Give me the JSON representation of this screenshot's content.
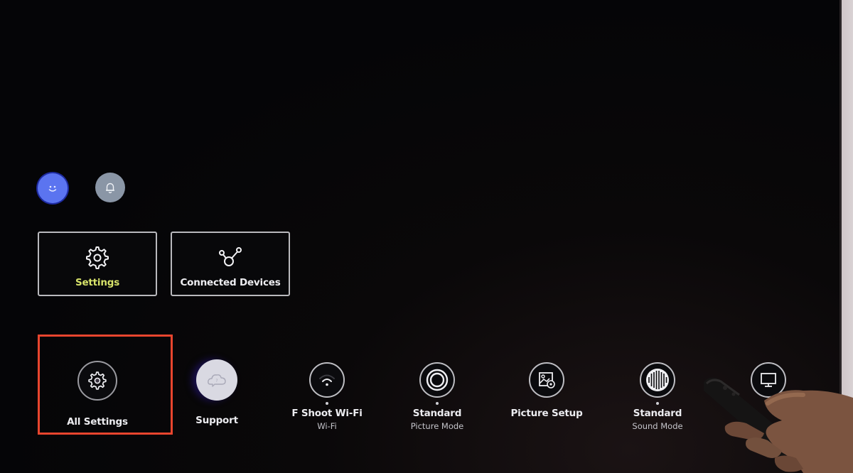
{
  "top_icons": [
    {
      "name": "profile",
      "icon": "smiley-face-icon",
      "color": "#5b74f0"
    },
    {
      "name": "notifications",
      "icon": "bell-icon",
      "color": "#8a96a6"
    }
  ],
  "quick_tiles": [
    {
      "label": "Settings",
      "icon": "gear-icon",
      "focused": true,
      "label_color": "#d8e36a"
    },
    {
      "label": "Connected Devices",
      "icon": "connected-nodes-icon",
      "focused": false
    }
  ],
  "bottom_items": [
    {
      "title": "All Settings",
      "subtitle": "",
      "icon": "gear-icon",
      "highlighted": true
    },
    {
      "title": "Support",
      "subtitle": "",
      "icon": "cloud-help-icon"
    },
    {
      "title": "F Shoot Wi-Fi",
      "subtitle": "Wi-Fi",
      "icon": "wifi-icon"
    },
    {
      "title": "Standard",
      "subtitle": "Picture Mode",
      "icon": "concentric-circles-icon"
    },
    {
      "title": "Picture Setup",
      "subtitle": "",
      "icon": "picture-setup-icon"
    },
    {
      "title": "Standard",
      "subtitle": "Sound Mode",
      "icon": "sound-wave-icon"
    },
    {
      "title": "",
      "subtitle": "",
      "icon": "tv-monitor-icon"
    }
  ],
  "highlight_color": "#e8452e"
}
